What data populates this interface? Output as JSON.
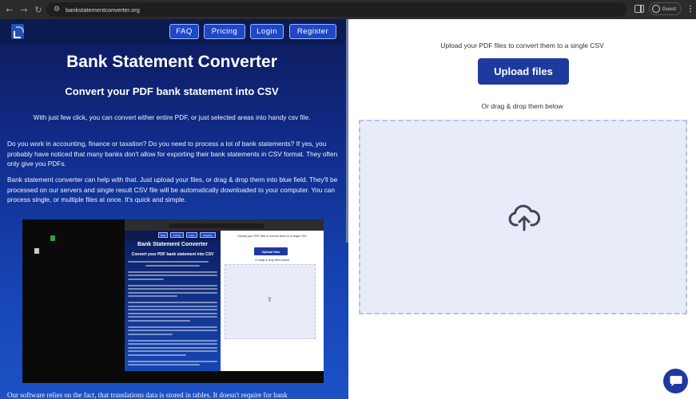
{
  "browser": {
    "url": "bankstatementconverter.org",
    "profile_label": "Guest",
    "icons": [
      "back-arrow-icon",
      "forward-arrow-icon",
      "reload-icon",
      "site-info-icon",
      "side-panel-icon",
      "profile-icon",
      "more-menu-icon"
    ]
  },
  "nav": {
    "faq": "FAQ",
    "pricing": "Pricing",
    "login": "Login",
    "register": "Register"
  },
  "hero": {
    "title": "Bank Statement Converter",
    "subtitle": "Convert your PDF bank statement into CSV",
    "intro": "With just few click, you can convert either entire PDF, or just selected areas into handy csv file.",
    "para1": "Do you work in accounting, finance or taxation? Do you need to process a lot of bank statements? If yes, you probably have noticed that many banks don't allow for exporting their bank statements in CSV format. They often only give you PDFs.",
    "para2": "Bank statement converter can help with that. Just upload your files, or drag & drop them into blue field. They'll be processed on our servers and single result CSV file will be automatically downloaded to your computer. You can process single, or multiple files at once. It's quick and simple.",
    "para3": "Our software relies on the fact, that translations data is stored in tables. It doesn't require for bank"
  },
  "upload": {
    "caption": "Upload your PDF files to convert them to a single CSV",
    "button_label": "Upload files",
    "drag_caption": "Or drag & drop them below",
    "drop_icon": "cloud-upload-icon"
  },
  "demo": {
    "title": "Bank Statement Converter",
    "subtitle": "Convert your PDF bank statement into CSV",
    "nav": [
      "FAQ",
      "Pricing",
      "Login",
      "Register"
    ],
    "upload_caption": "Upload your PDF files to convert them to a single CSV",
    "upload_button": "Upload files",
    "drag_caption": "Or drag & drop them below"
  },
  "colors": {
    "brand_blue": "#1f3a9e",
    "nav_bar": "#0b1a4f",
    "drop_zone": "#e8ebf8"
  }
}
